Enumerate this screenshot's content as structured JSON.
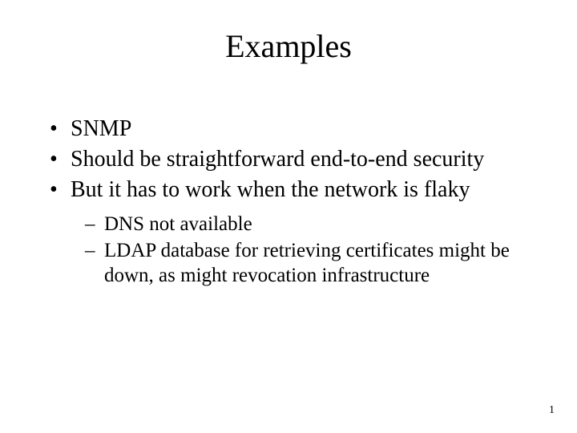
{
  "title": "Examples",
  "bullets": {
    "b0": "SNMP",
    "b1": "Should be straightforward end-to-end security",
    "b2": "But it has to work when the network is flaky"
  },
  "sub": {
    "s0": "DNS not available",
    "s1": "LDAP database for retrieving certificates might be down, as might revocation infrastructure"
  },
  "page_number": "1"
}
